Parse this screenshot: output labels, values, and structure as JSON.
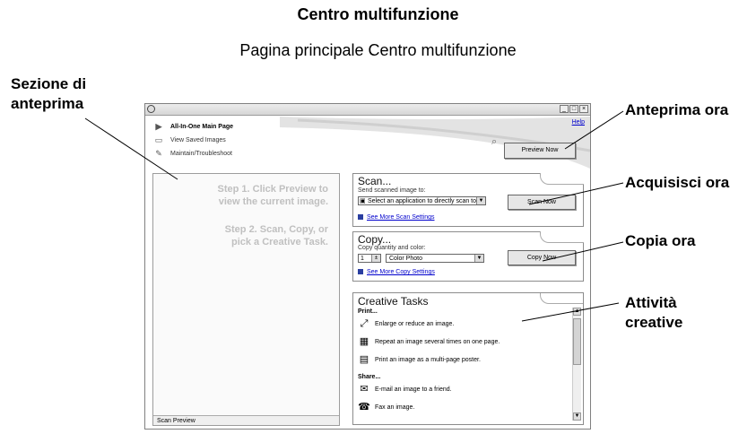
{
  "document": {
    "title": "Centro multifunzione",
    "subtitle": "Pagina principale Centro multifunzione"
  },
  "callouts": {
    "preview_section": [
      "Sezione di",
      "anteprima"
    ],
    "preview_now": "Anteprima ora",
    "scan_now": "Acquisisci ora",
    "copy_now": "Copia ora",
    "creative_tasks": [
      "Attività",
      "creative"
    ]
  },
  "window": {
    "controls": {
      "minimize": "_",
      "maximize": "□",
      "close": "×"
    },
    "nav": [
      {
        "label": "All-In-One Main Page",
        "icon": "play-arrow-icon"
      },
      {
        "label": "View Saved Images",
        "icon": "folder-icon"
      },
      {
        "label": "Maintain/Troubleshoot",
        "icon": "wrench-icon"
      }
    ],
    "help_link": "Help",
    "preview_now_button": "Preview Now",
    "preview_pane": {
      "step1": [
        "Step 1.  Click Preview to",
        "view the current image."
      ],
      "step2": [
        "Step 2.  Scan, Copy, or",
        "pick a Creative Task."
      ],
      "footer_label": "Scan Preview"
    },
    "scan": {
      "title": "Scan...",
      "subtitle": "Send scanned image to:",
      "destination_value": "Select an application to directly scan to.",
      "button": "Scan Now",
      "more_link": "See More Scan Settings"
    },
    "copy": {
      "title": "Copy...",
      "subtitle": "Copy quantity and color:",
      "quantity": "1",
      "color_value": "Color Photo",
      "button": "Copy Now",
      "more_link": "See More Copy Settings"
    },
    "creative": {
      "title": "Creative Tasks",
      "print_heading": "Print...",
      "share_heading": "Share...",
      "print_tasks": [
        "Enlarge or reduce an image.",
        "Repeat an image several times on one page.",
        "Print an image as a multi-page poster."
      ],
      "share_tasks": [
        "E-mail an image to a friend.",
        "Fax an image."
      ]
    }
  },
  "colors": {
    "link": "#0000cc",
    "step_text": "#c0c0c0"
  }
}
